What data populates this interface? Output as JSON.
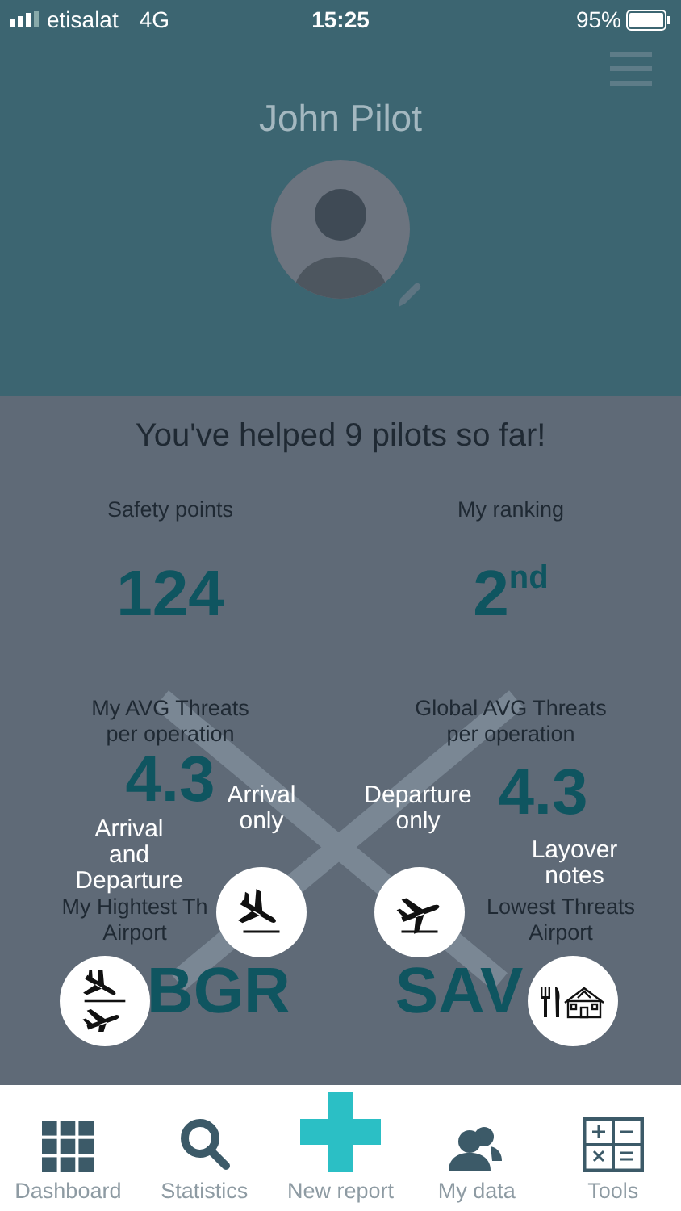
{
  "status_bar": {
    "carrier": "etisalat",
    "network": "4G",
    "time": "15:25",
    "battery": "95%"
  },
  "profile": {
    "name": "John Pilot"
  },
  "summary": "You've helped 9 pilots so far!",
  "stats": [
    {
      "label": "Safety points",
      "value": "124"
    },
    {
      "label": "My ranking",
      "value": "2$^{nd}$"
    },
    {
      "label": "My AVG Threats\nper operation",
      "value": "4.3"
    },
    {
      "label": "Global AVG Threats\nper operation",
      "value": "4.3"
    },
    {
      "label": "My Hightest Th\nAirport",
      "value": "BGR"
    },
    {
      "label": "Lowest Threats\nAirport",
      "value": "SAV"
    }
  ],
  "action_menu": [
    {
      "kind": "both",
      "label": "Arrival\nand\nDeparture"
    },
    {
      "kind": "arrival",
      "label": "Arrival\nonly"
    },
    {
      "kind": "departure",
      "label": "Departure\nonly"
    },
    {
      "kind": "layover",
      "label": "Layover\nnotes"
    }
  ],
  "tabs": [
    {
      "kind": "dashboard",
      "label": "Dashboard"
    },
    {
      "kind": "statistics",
      "label": "Statistics"
    },
    {
      "kind": "new",
      "label": "New report"
    },
    {
      "kind": "mydata",
      "label": "My data"
    },
    {
      "kind": "tools",
      "label": "Tools"
    }
  ]
}
